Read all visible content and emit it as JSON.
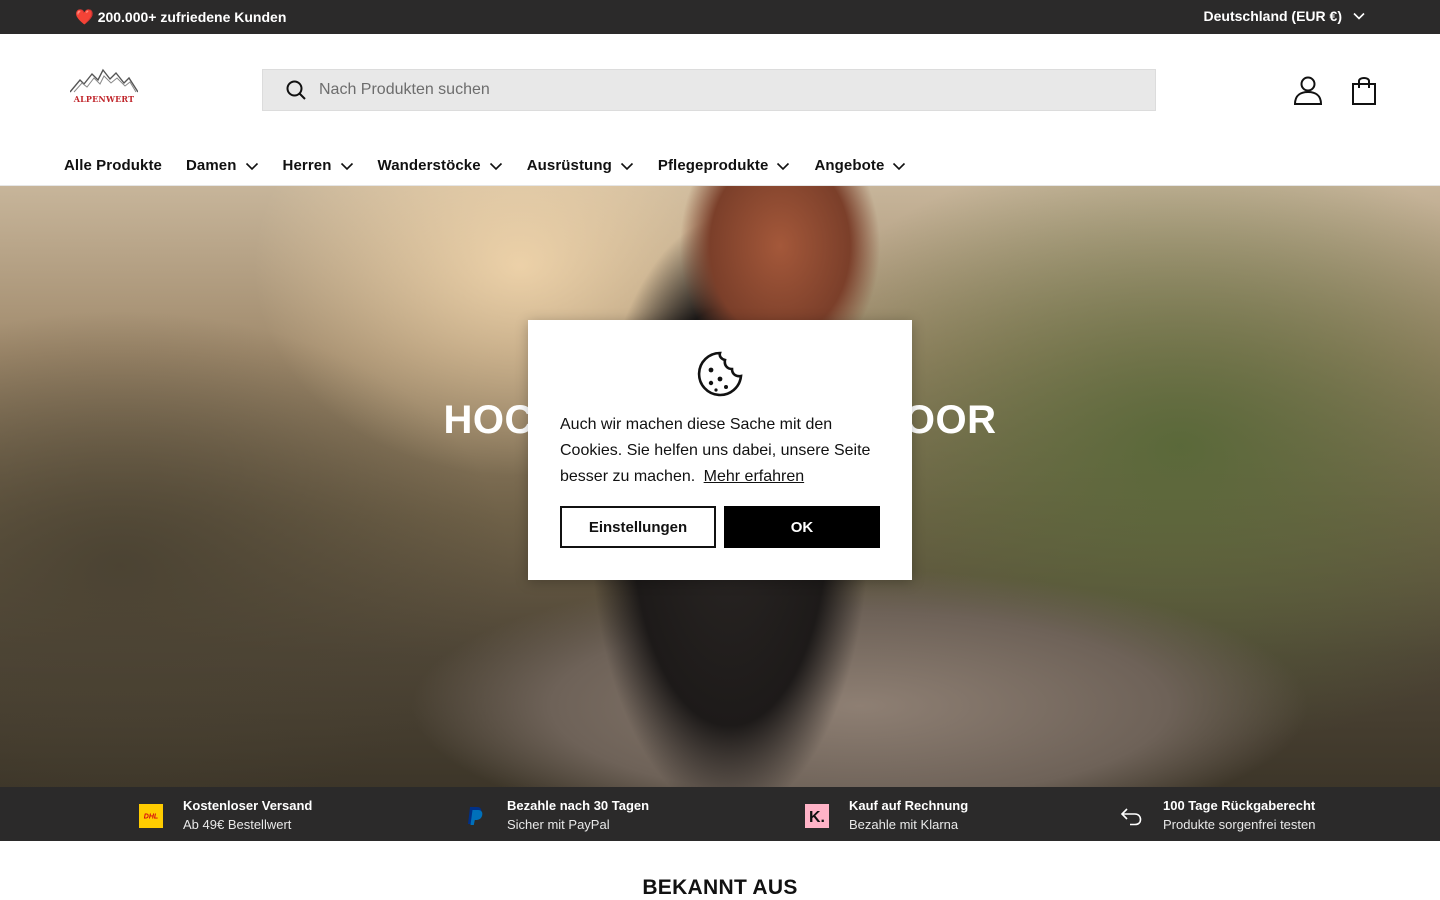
{
  "announcement": {
    "heart": "❤️",
    "text": "200.000+ zufriedene Kunden",
    "country": "Deutschland (EUR €)"
  },
  "header": {
    "logo_text": "ALPENWERT",
    "search_placeholder": "Nach Produkten suchen",
    "account_icon": "user-icon",
    "cart_icon": "shopping-bag-icon"
  },
  "nav": [
    {
      "label": "Alle Produkte",
      "has_dropdown": false
    },
    {
      "label": "Damen",
      "has_dropdown": true
    },
    {
      "label": "Herren",
      "has_dropdown": true
    },
    {
      "label": "Wanderstöcke",
      "has_dropdown": true
    },
    {
      "label": "Ausrüstung",
      "has_dropdown": true
    },
    {
      "label": "Pflegeprodukte",
      "has_dropdown": true
    },
    {
      "label": "Angebote",
      "has_dropdown": true
    }
  ],
  "hero": {
    "title_left": "HOC",
    "title_right": "OOR"
  },
  "cookie": {
    "text": "Auch wir machen diese Sache mit den Cookies. Sie helfen uns dabei, unsere Seite besser zu machen.",
    "link": "Mehr erfahren",
    "settings_button": "Einstellungen",
    "ok_button": "OK"
  },
  "trust": [
    {
      "icon": "dhl-icon",
      "title": "Kostenloser Versand",
      "sub": "Ab 49€ Bestellwert"
    },
    {
      "icon": "paypal-icon",
      "title": "Bezahle nach 30 Tagen",
      "sub": "Sicher mit PayPal"
    },
    {
      "icon": "klarna-icon",
      "title": "Kauf auf Rechnung",
      "sub": "Bezahle mit Klarna"
    },
    {
      "icon": "return-arrow-icon",
      "title": "100 Tage Rückgaberecht",
      "sub": "Produkte sorgenfrei testen"
    }
  ],
  "known_section": {
    "title": "BEKANNT AUS"
  },
  "colors": {
    "dark_bar": "#2b2a2a",
    "search_bg": "#e8e8e8",
    "logo_red": "#c0262b",
    "dhl_yellow": "#ffcc00",
    "klarna_pink": "#ffb3c7",
    "paypal_blue": "#0070ba"
  }
}
